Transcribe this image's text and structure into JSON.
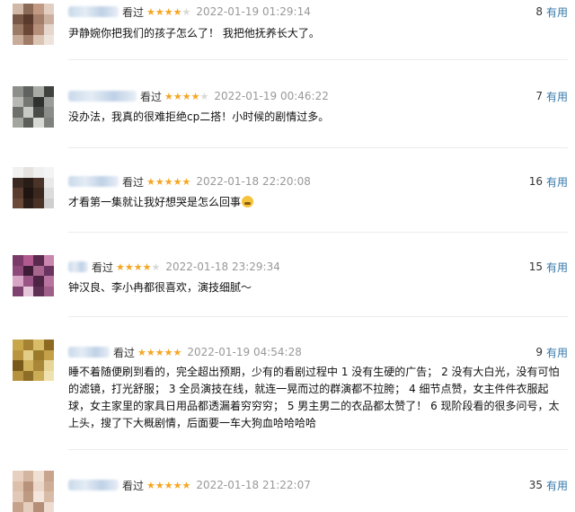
{
  "colors": {
    "star_on": "#f5a623",
    "star_off": "#d8d8d8",
    "useful_link": "#3377aa",
    "time": "#999999"
  },
  "comments": [
    {
      "action": "看过",
      "rating": 4,
      "time": "2022-01-19 01:29:14",
      "useful_count": "8",
      "useful_label": "有用",
      "text": "尹静婉你把我们的孩子怎么了！ 我把他抚养长大了。"
    },
    {
      "action": "看过",
      "rating": 4,
      "time": "2022-01-19 00:46:22",
      "useful_count": "7",
      "useful_label": "有用",
      "text": "没办法，我真的很难拒绝cp二搭！小时候的剧情过多。"
    },
    {
      "action": "看过",
      "rating": 5,
      "time": "2022-01-18 22:20:08",
      "useful_count": "16",
      "useful_label": "有用",
      "text": "才看第一集就让我好想哭是怎么回事",
      "emoji": "crying-face-icon"
    },
    {
      "action": "看过",
      "rating": 4,
      "time": "2022-01-18 23:29:34",
      "useful_count": "15",
      "useful_label": "有用",
      "text": "钟汉良、李小冉都很喜欢，演技细腻～"
    },
    {
      "action": "看过",
      "rating": 5,
      "time": "2022-01-19 04:54:28",
      "useful_count": "9",
      "useful_label": "有用",
      "text": "睡不着随便刷到看的，完全超出预期，少有的看剧过程中 1 没有生硬的广告； 2 没有大白光，没有可怕的滤镜，打光舒服； 3 全员演技在线，就连一晃而过的群演都不拉胯； 4 细节点赞，女主件件衣服起球，女主家里的家具日用品都透漏着穷穷穷； 5 男主男二的衣品都太赞了！ 6 现阶段看的很多问号，太上头，搜了下大概剧情，后面要一车大狗血哈哈哈哈"
    },
    {
      "action": "看过",
      "rating": 5,
      "time": "2022-01-18 21:22:07",
      "useful_count": "35",
      "useful_label": "有用",
      "text": ""
    }
  ]
}
